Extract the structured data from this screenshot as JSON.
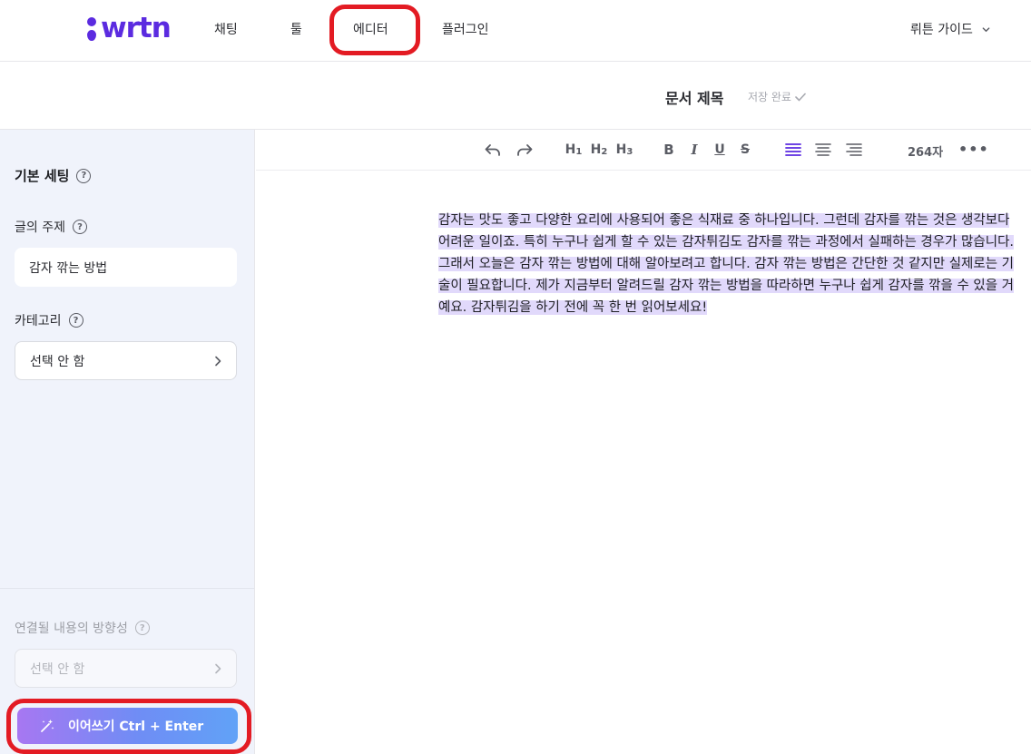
{
  "brand": {
    "logo_text": "wrtn",
    "color": "#5b2be0"
  },
  "nav": {
    "items": [
      {
        "label": "채팅"
      },
      {
        "label": "툴"
      },
      {
        "label": "에디터"
      },
      {
        "label": "플러그인"
      }
    ],
    "guide_label": "뤼튼 가이드",
    "highlight_color": "#e31b23"
  },
  "document": {
    "title": "문서 제목",
    "save_status": "저장 완료"
  },
  "sidebar": {
    "section_title": "기본 세팅",
    "topic_label": "글의 주제",
    "topic_value": "감자 깎는 방법",
    "category_label": "카테고리",
    "category_value": "선택 안 함",
    "direction_label": "연결될 내용의 방향성",
    "direction_value": "선택 안 함",
    "continue_button": "이어쓰기 Ctrl + Enter",
    "help_icon": "?"
  },
  "toolbar": {
    "undo_icon": "undo-icon",
    "redo_icon": "redo-icon",
    "headings": [
      "H",
      "H",
      "H"
    ],
    "heading_levels": [
      "1",
      "2",
      "3"
    ],
    "bold": "B",
    "italic": "I",
    "underline": "U",
    "strike": "S",
    "char_count": "264자",
    "more": "•••",
    "active_color": "#5b2be0"
  },
  "content": {
    "text": "감자는 맛도 좋고 다양한 요리에 사용되어 좋은 식재료 중 하나입니다. 그런데 감자를 깎는 것은 생각보다 어려운 일이죠. 특히 누구나 쉽게 할 수 있는 감자튀김도 감자를 깎는 과정에서 실패하는 경우가 많습니다. 그래서 오늘은 감자 깎는 방법에 대해 알아보려고 합니다. 감자 깎는 방법은 간단한 것 같지만 실제로는 기술이 필요합니다. 제가 지금부터 알려드릴 감자 깎는 방법을 따라하면 누구나 쉽게 감자를 깎을 수 있을 거예요. 감자튀김을 하기 전에 꼭 한 번 읽어보세요!",
    "highlight_color": "#e1d9fb"
  }
}
